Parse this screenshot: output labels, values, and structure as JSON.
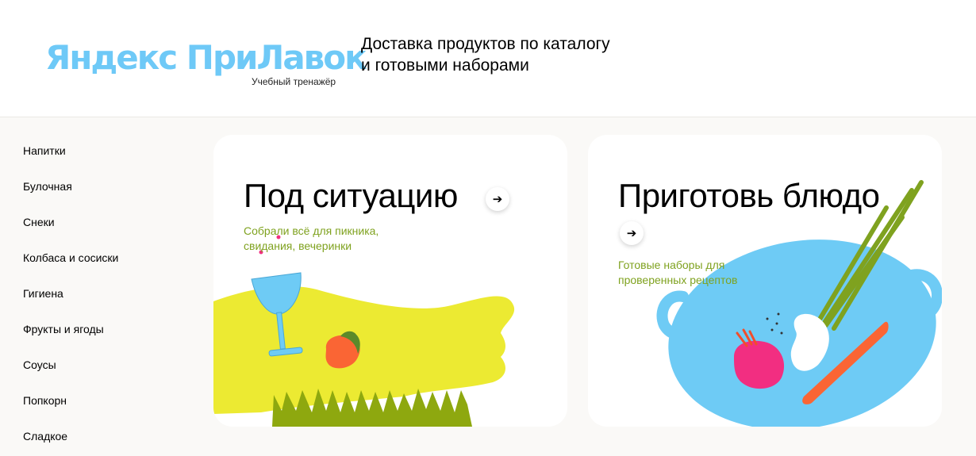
{
  "header": {
    "logo_text": "Яндекс ПриЛавок",
    "logo_subtitle": "Учебный тренажёр",
    "tagline_line1": "Доставка продуктов по каталогу",
    "tagline_line2": "и готовыми наборами"
  },
  "sidebar": {
    "items": [
      {
        "label": "Напитки"
      },
      {
        "label": "Булочная"
      },
      {
        "label": "Снеки"
      },
      {
        "label": "Колбаса и сосиски"
      },
      {
        "label": "Гигиена"
      },
      {
        "label": "Фрукты и ягоды"
      },
      {
        "label": "Соусы"
      },
      {
        "label": "Попкорн"
      },
      {
        "label": "Сладкое"
      }
    ]
  },
  "cards": [
    {
      "title": "Под ситуацию",
      "description": "Собрали всё для пикника, свидания, вечеринки",
      "arrow_icon": "arrow-right-icon",
      "illustration": "picnic-illustration"
    },
    {
      "title": "Приготовь блюдо",
      "description": "Готовые наборы для проверенных рецептов",
      "arrow_icon": "arrow-right-icon",
      "illustration": "pot-illustration"
    }
  ],
  "colors": {
    "logo": "#6ec9f7",
    "accent_green": "#7fa21f",
    "yellow": "#ecea32",
    "blue": "#6ecbf5",
    "pink": "#f22e81",
    "orange": "#fa6534"
  }
}
